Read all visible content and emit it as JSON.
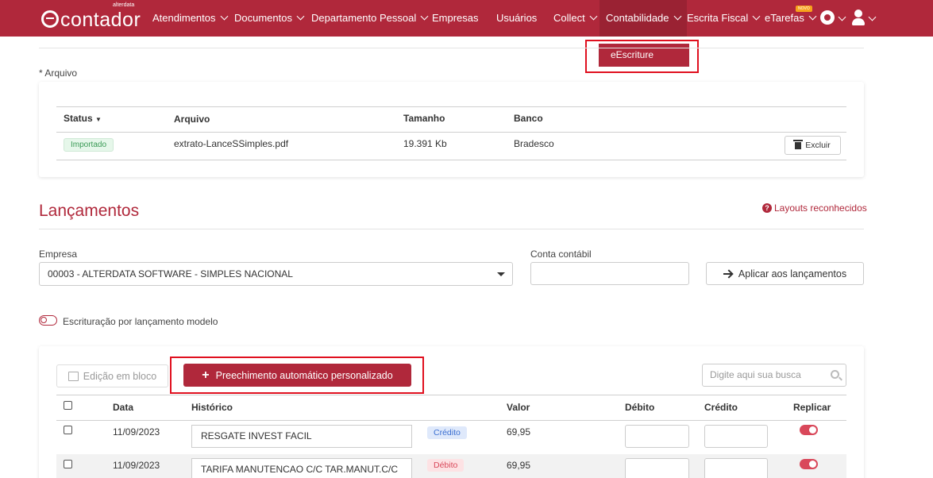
{
  "nav": {
    "logo_text": "contador",
    "logo_sub": "alterdata",
    "items": [
      {
        "label": "Atendimentos"
      },
      {
        "label": "Documentos"
      },
      {
        "label": "Departamento Pessoal"
      },
      {
        "label": "Empresas"
      },
      {
        "label": "Usuários"
      },
      {
        "label": "Collect"
      },
      {
        "label": "Contabilidade"
      },
      {
        "label": "Escrita Fiscal"
      },
      {
        "label": "eTarefas"
      }
    ],
    "badge_novo": "NOVO",
    "settings_icon": "gear-icon",
    "user_icon": "user-icon"
  },
  "dropdown": {
    "item": "eEscriture"
  },
  "arquivo": {
    "label": "* Arquivo",
    "headers": {
      "status": "Status",
      "arquivo": "Arquivo",
      "tamanho": "Tamanho",
      "banco": "Banco"
    },
    "row": {
      "status": "Importado",
      "arquivo": "extrato-LanceSSimples.pdf",
      "tamanho": "19.391 Kb",
      "banco": "Bradesco",
      "action": "Excluir"
    }
  },
  "lancamentos": {
    "title": "Lançamentos",
    "layouts_link": "Layouts reconhecidos",
    "empresa_label": "Empresa",
    "empresa_value": "00003 - ALTERDATA SOFTWARE - SIMPLES NACIONAL",
    "conta_label": "Conta contábil",
    "aplicar_button": "Aplicar aos lançamentos",
    "toggle_label": "Escrituração por lançamento modelo"
  },
  "toolbar": {
    "edicao_button": "Edição em bloco",
    "preench_button": "Preechimento automático personalizado",
    "search_placeholder": "Digite aqui sua busca"
  },
  "table": {
    "headers": {
      "data": "Data",
      "historico": "Histórico",
      "valor": "Valor",
      "debito": "Débito",
      "credito": "Crédito",
      "replicar": "Replicar"
    },
    "rows": [
      {
        "data": "11/09/2023",
        "historico": "RESGATE INVEST FACIL",
        "tipo": "Crédito",
        "valor": "69,95"
      },
      {
        "data": "11/09/2023",
        "historico": "TARIFA MANUTENCAO C/C TAR.MANUT.C/C",
        "tipo": "Débito",
        "valor": "69,95"
      }
    ]
  },
  "colors": {
    "brand": "#b0283b",
    "highlight": "#e0101f"
  }
}
